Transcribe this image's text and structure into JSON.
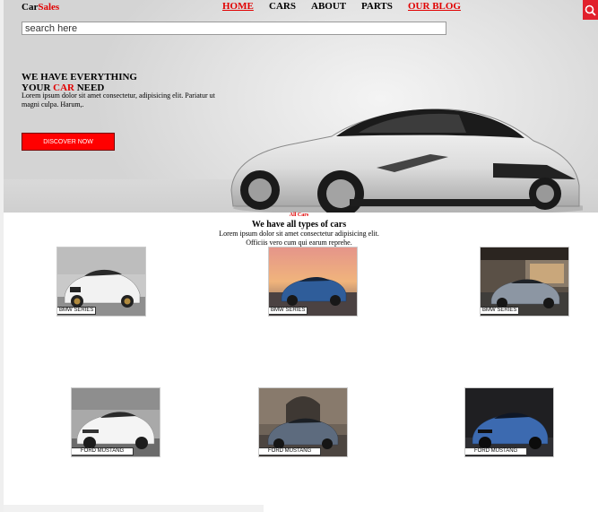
{
  "brand": {
    "part1": "Car",
    "part2": "Sales"
  },
  "nav": [
    {
      "label": "HOME",
      "active": true
    },
    {
      "label": "CARS",
      "active": false
    },
    {
      "label": "ABOUT",
      "active": false
    },
    {
      "label": "PARTS",
      "active": false
    },
    {
      "label": "OUR BLOG",
      "active": true
    }
  ],
  "search": {
    "placeholder": "search here",
    "icon": "search-icon"
  },
  "hero": {
    "heading_line1": "WE HAVE EVERYTHING",
    "heading_line2_pre": "YOUR ",
    "heading_line2_accent": "CAR",
    "heading_line2_post": " NEED",
    "text": "Lorem ipsum dolor sit amet consectetur, adipisicing elit. Pariatur ut magni culpa. Harum,.",
    "button": "DISCOVER NOW"
  },
  "section": {
    "tag": "All Cars",
    "title": "We have all types of cars",
    "text_line1": "Lorem ipsum dolor sit amet consectetur adipisicing elit.",
    "text_line2": "Officiis vero cum qui earum reprehe."
  },
  "cars": [
    {
      "label": "BMW SERIES"
    },
    {
      "label": "BMW SERIES"
    },
    {
      "label": "BMW SERIES"
    },
    {
      "label": "FORD MUSTANG"
    },
    {
      "label": "FORD MUSTANG"
    },
    {
      "label": "FORD MUSTANG"
    }
  ],
  "colors": {
    "accent": "#e10000",
    "button": "#ff0000",
    "search_button": "#e1202b"
  }
}
